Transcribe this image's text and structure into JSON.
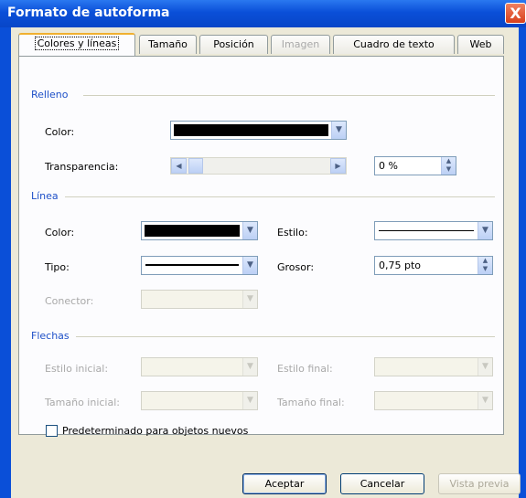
{
  "window": {
    "title": "Formato de autoforma",
    "close": "X"
  },
  "tabs": [
    {
      "label": "Colores y líneas",
      "active": true,
      "disabled": false
    },
    {
      "label": "Tamaño",
      "active": false,
      "disabled": false
    },
    {
      "label": "Posición",
      "active": false,
      "disabled": false
    },
    {
      "label": "Imagen",
      "active": false,
      "disabled": true
    },
    {
      "label": "Cuadro de texto",
      "active": false,
      "disabled": false
    },
    {
      "label": "Web",
      "active": false,
      "disabled": false
    }
  ],
  "relleno": {
    "section": "Relleno",
    "color_label": "Color:",
    "color_value": "#000000",
    "transparency_label": "Transparencia:",
    "transparency_value": "0 %",
    "transparency_percent": 0
  },
  "linea": {
    "section": "Línea",
    "color_label": "Color:",
    "color_value": "#000000",
    "tipo_label": "Tipo:",
    "conector_label": "Conector:",
    "estilo_label": "Estilo:",
    "grosor_label": "Grosor:",
    "grosor_value": "0,75 pto"
  },
  "flechas": {
    "section": "Flechas",
    "estilo_inicial_label": "Estilo inicial:",
    "tamano_inicial_label": "Tamaño inicial:",
    "estilo_final_label": "Estilo final:",
    "tamano_final_label": "Tamaño final:"
  },
  "default_checkbox": {
    "label": "Predeterminado para objetos nuevos",
    "checked": false
  },
  "buttons": {
    "accept": "Aceptar",
    "cancel": "Cancelar",
    "preview": "Vista previa"
  },
  "colors": {
    "titlebar": "#0a4fd8",
    "section": "#1e50c8",
    "dialog_bg": "#ece9d8"
  },
  "icons": {
    "dropdown": "chevron-down-icon",
    "spin_up": "arrow-up-icon",
    "spin_down": "arrow-down-icon",
    "scroll_left": "arrow-left-icon",
    "scroll_right": "arrow-right-icon"
  }
}
